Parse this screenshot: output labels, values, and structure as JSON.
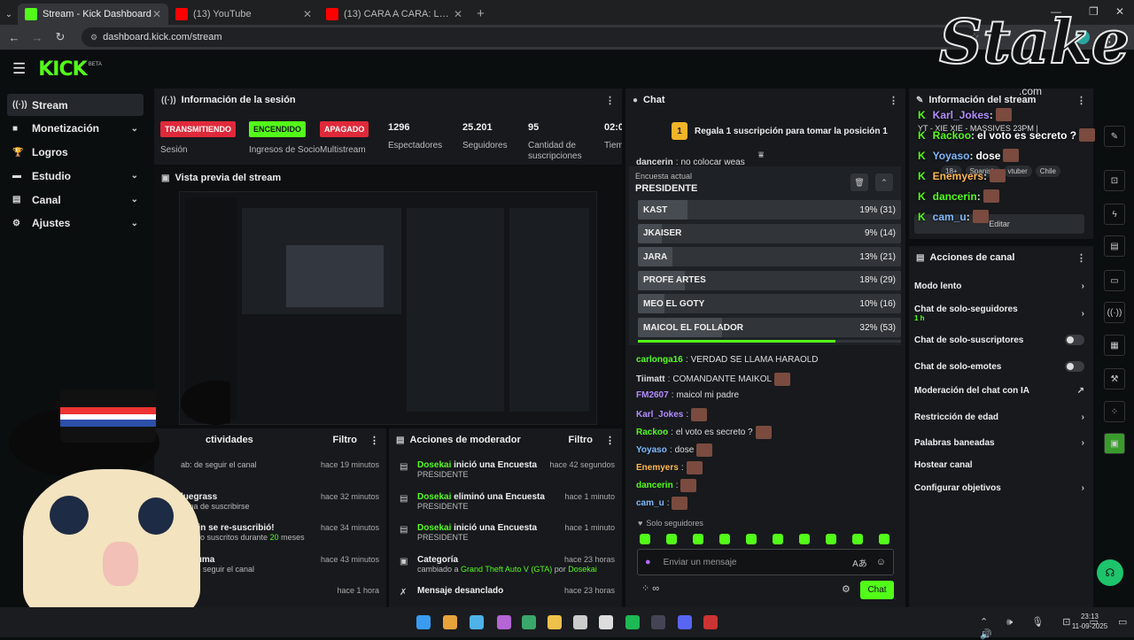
{
  "browser": {
    "tabs": [
      {
        "title": "Stream - Kick Dashboard",
        "active": true,
        "color": "#53fc18"
      },
      {
        "title": "(13) YouTube",
        "active": false,
        "color": "#ff0000"
      },
      {
        "title": "(13) CARA A CARA: La ronda de",
        "active": false,
        "color": "#ff0000"
      }
    ],
    "url": "dashboard.kick.com/stream"
  },
  "app": {
    "logo": "KICK",
    "beta": "BETA"
  },
  "sidebar": {
    "items": [
      {
        "label": "Stream",
        "icon": "stream-icon",
        "active": true,
        "chev": false
      },
      {
        "label": "Monetización",
        "icon": "monetization-icon",
        "active": false,
        "chev": true
      },
      {
        "label": "Logros",
        "icon": "trophy-icon",
        "active": false,
        "chev": false
      },
      {
        "label": "Estudio",
        "icon": "studio-icon",
        "active": false,
        "chev": true
      },
      {
        "label": "Canal",
        "icon": "channel-icon",
        "active": false,
        "chev": true
      },
      {
        "label": "Ajustes",
        "icon": "gear-icon",
        "active": false,
        "chev": true
      }
    ]
  },
  "session": {
    "title": "Información de la sesión",
    "stats": [
      {
        "badge": "TRANSMITIENDO",
        "badge_color": "#e0293a",
        "label": "Sesión"
      },
      {
        "badge": "ENCENDIDO",
        "badge_color": "#53fc18",
        "label": "Ingresos de Socio"
      },
      {
        "badge": "APAGADO",
        "badge_color": "#e0293a",
        "label": "Multistream"
      },
      {
        "value": "1296",
        "label": "Espectadores"
      },
      {
        "value": "25.201",
        "label": "Seguidores"
      },
      {
        "value": "95",
        "label": "Cantidad de suscripciones"
      },
      {
        "value": "02:0",
        "label": "Tiem en vi"
      }
    ]
  },
  "preview": {
    "title": "Vista previa del stream"
  },
  "activities": {
    "title": "ctividades",
    "filter": "Filtro",
    "rows": [
      {
        "title": "",
        "sub": "ab: de seguir el canal",
        "time": "hace 19 minutos"
      },
      {
        "title": "luegrass",
        "sub": "caba de suscribirse",
        "time": "hace 32 minutos"
      },
      {
        "title": "zuelin se re-suscribió!",
        "sub": "estado suscritos durante 20 meses",
        "time": "hace 34 minutos"
      },
      {
        "title": "onxuma",
        "sub": "ba de seguir el canal",
        "time": "hace 43 minutos"
      },
      {
        "title": "Z42",
        "sub": "",
        "time": "hace 1 hora"
      }
    ]
  },
  "modactions": {
    "title": "Acciones de moderador",
    "filter": "Filtro",
    "rows": [
      {
        "user": "Dosekai",
        "action": "inició una Encuesta",
        "sub": "PRESIDENTE",
        "time": "hace 42 segundos"
      },
      {
        "user": "Dosekai",
        "action": "eliminó una Encuesta",
        "sub": "PRESIDENTE",
        "time": "hace 1 minuto"
      },
      {
        "user": "Dosekai",
        "action": "inició una Encuesta",
        "sub": "PRESIDENTE",
        "time": "hace 1 minuto"
      },
      {
        "user": "",
        "action": "Categoría",
        "sub": "cambiado a Grand Theft Auto V (GTA) por Dosekai",
        "time": "hace 23 horas"
      },
      {
        "user": "",
        "action": "Mensaje desanclado",
        "sub": "",
        "time": "hace 23 horas"
      }
    ]
  },
  "chat": {
    "title": "Chat",
    "sub_rank": "1",
    "sub_prompt": "Regala 1 suscripción para tomar la posición 1",
    "prev_msg": {
      "user": "dancerin",
      "text": "no colocar weas"
    },
    "poll": {
      "label": "Encuesta actual",
      "title": "PRESIDENTE",
      "options": [
        {
          "name": "KAST",
          "pct": "19% (31)",
          "share": 0.19
        },
        {
          "name": "JKAISER",
          "pct": "9% (14)",
          "share": 0.09
        },
        {
          "name": "JARA",
          "pct": "13% (21)",
          "share": 0.13
        },
        {
          "name": "PROFE ARTES",
          "pct": "18% (29)",
          "share": 0.18
        },
        {
          "name": "MEO EL GOTY",
          "pct": "10% (16)",
          "share": 0.1
        },
        {
          "name": "MAICOL EL FOLLADOR",
          "pct": "32% (53)",
          "share": 0.32
        }
      ],
      "progress": 0.75
    },
    "messages": [
      {
        "user": "carlonga16",
        "text": "VERDAD SE LLAMA HARAOLD",
        "color": "#53fc18",
        "emote": false
      },
      {
        "user": "Tiimatt",
        "text": "COMANDANTE MAIKOL",
        "color": "#ddd",
        "emote": true
      },
      {
        "user": "FM2607",
        "text": "maicol mi padre",
        "color": "#b38cff",
        "emote": false
      },
      {
        "user": "Karl_Jokes",
        "text": "",
        "color": "#b38cff",
        "emote": true
      },
      {
        "user": "Rackoo",
        "text": "el voto es secreto ?",
        "color": "#53fc18",
        "emote": true
      },
      {
        "user": "Yoyaso",
        "text": "dose",
        "color": "#7fb8ff",
        "emote": true
      },
      {
        "user": "Enemyers",
        "text": "",
        "color": "#ffb84d",
        "emote": true
      },
      {
        "user": "dancerin",
        "text": "",
        "color": "#53fc18",
        "emote": true
      },
      {
        "user": "cam_u",
        "text": "",
        "color": "#7fb8ff",
        "emote": true
      }
    ],
    "mode": "Solo seguidores",
    "placeholder": "Enviar un mensaje",
    "send": "Chat"
  },
  "stream_info": {
    "title": "Información del stream",
    "stream_title": "YT - XIE XIE - MASSIVES 23PM |",
    "tags": [
      "18+",
      "Spanish",
      "vtuber",
      "Chile"
    ],
    "edit": "Editar"
  },
  "channel_actions": {
    "title": "Acciones de canal",
    "items": [
      {
        "label": "Modo lento",
        "sub": "",
        "ctl": "chev"
      },
      {
        "label": "Chat de solo-seguidores",
        "sub": "1 h",
        "ctl": "chev"
      },
      {
        "label": "Chat de solo-suscriptores",
        "sub": "",
        "ctl": "toggle"
      },
      {
        "label": "Chat de solo-emotes",
        "sub": "",
        "ctl": "toggle"
      },
      {
        "label": "Moderación del chat con IA",
        "sub": "",
        "ctl": "ext"
      },
      {
        "label": "Restricción de edad",
        "sub": "",
        "ctl": "chev"
      },
      {
        "label": "Palabras baneadas",
        "sub": "",
        "ctl": "chev"
      },
      {
        "label": "Hostear canal",
        "sub": "",
        "ctl": "none"
      },
      {
        "label": "Configurar objetivos",
        "sub": "",
        "ctl": "chev"
      }
    ]
  },
  "overlay": {
    "stake": "Stake",
    "stake_com": ".com",
    "chat": [
      {
        "user": "Karl_Jokes",
        "text": "",
        "color": "#b38cff"
      },
      {
        "user": "Rackoo",
        "text": "el voto es secreto ?",
        "color": "#53fc18"
      },
      {
        "user": "Yoyaso",
        "text": "dose",
        "color": "#7fb8ff"
      },
      {
        "user": "Enemyers",
        "text": "",
        "color": "#ffb84d"
      },
      {
        "user": "dancerin",
        "text": "",
        "color": "#53fc18"
      },
      {
        "user": "cam_u",
        "text": "",
        "color": "#7fb8ff"
      }
    ]
  },
  "taskbar": {
    "time": "23:13",
    "date": "11-09-2025"
  },
  "colors": {
    "kick_green": "#53fc18",
    "panel": "#17191c"
  }
}
